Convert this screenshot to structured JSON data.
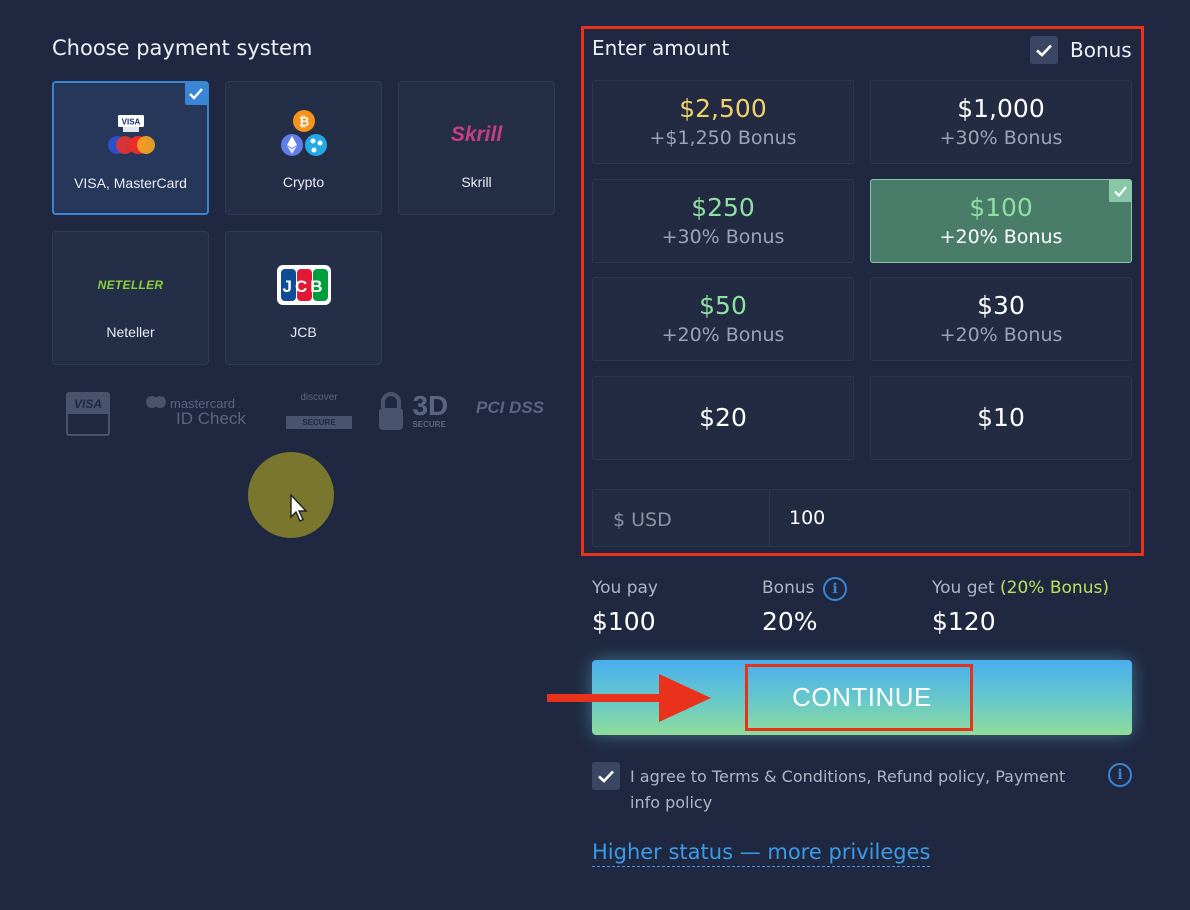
{
  "payment": {
    "title": "Choose payment system",
    "methods": [
      {
        "label": "VISA, MasterCard",
        "selected": true
      },
      {
        "label": "Crypto",
        "selected": false
      },
      {
        "label": "Skrill",
        "selected": false
      },
      {
        "label": "Neteller",
        "selected": false
      },
      {
        "label": "JCB",
        "selected": false
      }
    ],
    "logo_texts": {
      "visa": "VISA",
      "skrill": "Skrill",
      "neteller": "NETELLER",
      "jcb": "JCB"
    },
    "trust_badges": {
      "visa": "VISA",
      "mastercard": "mastercard",
      "mastercard_sub": "ID Check",
      "discover": "discover",
      "discover_sub": "SECURE",
      "secure3d": "3D",
      "secure3d_sub": "SECURE",
      "pci": "PCI DSS"
    }
  },
  "amount": {
    "title": "Enter amount",
    "bonus_label": "Bonus",
    "bonus_checked": true,
    "options": [
      {
        "value": "$2,500",
        "bonus": "+$1,250 Bonus",
        "color": "#f2d36a"
      },
      {
        "value": "$1,000",
        "bonus": "+30% Bonus",
        "color": "#ffffff"
      },
      {
        "value": "$250",
        "bonus": "+30% Bonus",
        "color": "#8ee0a2"
      },
      {
        "value": "$100",
        "bonus": "+20% Bonus",
        "color": "#8ee0a2",
        "active": true
      },
      {
        "value": "$50",
        "bonus": "+20% Bonus",
        "color": "#8ee0a2"
      },
      {
        "value": "$30",
        "bonus": "+20% Bonus",
        "color": "#ffffff"
      },
      {
        "value": "$20",
        "bonus": "",
        "color": "#ffffff"
      },
      {
        "value": "$10",
        "bonus": "",
        "color": "#ffffff"
      }
    ],
    "currency_label": "$ USD",
    "input_value": "100"
  },
  "summary": {
    "you_pay_label": "You pay",
    "you_pay_value": "$100",
    "bonus_label": "Bonus",
    "bonus_value": "20%",
    "you_get_label": "You get",
    "you_get_bonus": "(20% Bonus)",
    "you_get_value": "$120"
  },
  "continue_label": "CONTINUE",
  "agree": {
    "checked": true,
    "text": "I agree to Terms & Conditions, Refund policy, Payment info policy"
  },
  "status_link": "Higher status — more privileges",
  "colors": {
    "accent": "#3a86d4",
    "highlight_red": "#e8321c",
    "selected_amount": "#4a7c6a",
    "bonus_green": "#b9e35c"
  }
}
